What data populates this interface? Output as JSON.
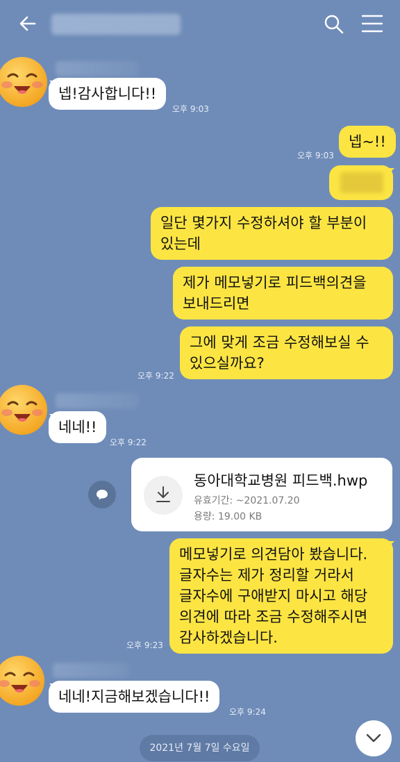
{
  "colors": {
    "background": "#6f8cb8",
    "my_bubble": "#fce543",
    "their_bubble": "#ffffff"
  },
  "header": {
    "back_icon": "arrow-left-icon",
    "search_icon": "search-icon",
    "menu_icon": "hamburger-menu-icon"
  },
  "messages": [
    {
      "sender": "them",
      "text": "넵!감사합니다!!",
      "time": "오후 9:03"
    },
    {
      "sender": "me",
      "text": "넵~!!",
      "time": "오후 9:03"
    },
    {
      "sender": "me",
      "text": ""
    },
    {
      "sender": "me",
      "text": "일단 몇가지 수정하셔야 할 부분이\n있는데"
    },
    {
      "sender": "me",
      "text": "제가 메모넣기로 피드백의견을\n보내드리면"
    },
    {
      "sender": "me",
      "text": "그에 맞게 조금 수정해보실 수\n있으실까요?",
      "time": "오후 9:22"
    },
    {
      "sender": "them",
      "text": "네네!!",
      "time": "오후 9:22"
    },
    {
      "sender": "me",
      "text": "메모넣기로 의견담아 봤습니다.\n글자수는 제가 정리할 거라서\n글자수에 구애받지 마시고 해당\n의견에 따라 조금 수정해주시면\n감사하겠습니다.",
      "time": "오후 9:23"
    },
    {
      "sender": "them",
      "text": "네네!지금해보겠습니다!!",
      "time": "오후 9:24"
    }
  ],
  "file": {
    "name": "동아대학교병원 피드백.hwp",
    "expiry": "유효기간: ~2021.07.20",
    "size": "용량: 19.00 KB",
    "icon": "download-icon"
  },
  "date_divider": "2021년 7월 7일 수요일"
}
